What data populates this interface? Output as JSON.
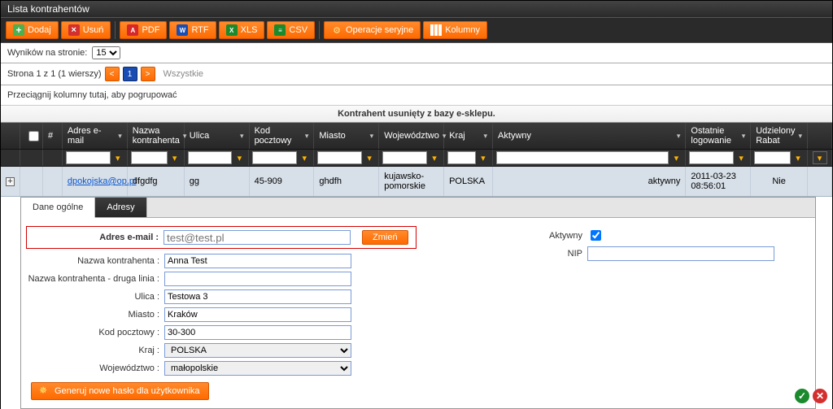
{
  "title": "Lista kontrahentów",
  "toolbar": {
    "add": "Dodaj",
    "del": "Usuń",
    "pdf": "PDF",
    "rtf": "RTF",
    "xls": "XLS",
    "csv": "CSV",
    "series": "Operacje seryjne",
    "cols": "Kolumny"
  },
  "pager": {
    "per_page_label": "Wyników na stronie:",
    "per_page_value": "15",
    "info": "Strona 1 z 1 (1 wierszy)",
    "all": "Wszystkie"
  },
  "group_hint": "Przeciągnij kolumny tutaj, aby pogrupować",
  "banner": "Kontrahent usunięty z bazy e-sklepu.",
  "columns": {
    "num": "#",
    "email": "Adres e-mail",
    "name": "Nazwa kontrahenta",
    "street": "Ulica",
    "zip": "Kod pocztowy",
    "city": "Miasto",
    "woj": "Województwo",
    "kraj": "Kraj",
    "active": "Aktywny",
    "lastlog": "Ostatnie logowanie",
    "rabat": "Udzielony Rabat"
  },
  "row0": {
    "email": "dpokojska@op.pl",
    "name": "dfgdfg",
    "street": "gg",
    "zip": "45-909",
    "city": "ghdfh",
    "woj": "kujawsko-pomorskie",
    "kraj": "POLSKA",
    "active": "aktywny",
    "lastlog": "2011-03-23 08:56:01",
    "rabat": "Nie"
  },
  "tabs": {
    "general": "Dane ogólne",
    "addresses": "Adresy"
  },
  "form": {
    "email_label": "Adres e-mail :",
    "email_placeholder": "test@test.pl",
    "zmien": "Zmień",
    "name_label": "Nazwa kontrahenta :",
    "name_value": "Anna Test",
    "name2_label": "Nazwa kontrahenta - druga linia :",
    "name2_value": "",
    "street_label": "Ulica :",
    "street_value": "Testowa 3",
    "city_label": "Miasto :",
    "city_value": "Kraków",
    "zip_label": "Kod pocztowy :",
    "zip_value": "30-300",
    "kraj_label": "Kraj :",
    "kraj_value": "POLSKA",
    "woj_label": "Województwo :",
    "woj_value": "małopolskie",
    "gen_btn": "Generuj nowe hasło dla użytkownika",
    "aktywny_label": "Aktywny",
    "nip_label": "NIP",
    "nip_value": ""
  }
}
